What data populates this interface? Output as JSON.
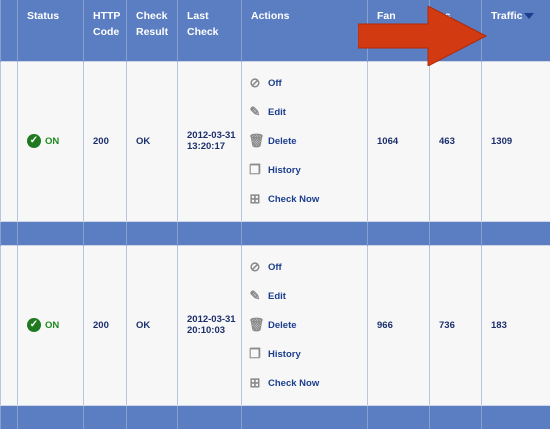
{
  "headers": {
    "status": "Status",
    "http_code": "HTTP Code",
    "check_result": "Check Result",
    "last_check": "Last Check",
    "actions": "Actions",
    "col6": "Fan",
    "col7": "es",
    "traffic": "Traffic"
  },
  "actions": {
    "off": "Off",
    "edit": "Edit",
    "delete": "Delete",
    "history": "History",
    "check_now": "Check Now"
  },
  "rows": [
    {
      "status": "ON",
      "http_code": "200",
      "check_result": "OK",
      "last_check_date": "2012-03-31",
      "last_check_time": "13:20:17",
      "col6": "1064",
      "col7": "463",
      "traffic": "1309"
    },
    {
      "status": "ON",
      "http_code": "200",
      "check_result": "OK",
      "last_check_date": "2012-03-31",
      "last_check_time": "20:10:03",
      "col6": "966",
      "col7": "736",
      "traffic": "183"
    }
  ],
  "colors": {
    "header_bg": "#5b7dc1",
    "arrow": "#d23a12",
    "status_on": "#1f8a1f"
  },
  "icons": {
    "status": "check-circle-icon",
    "sort": "sort-desc-icon",
    "pointer": "red-arrow-icon"
  }
}
